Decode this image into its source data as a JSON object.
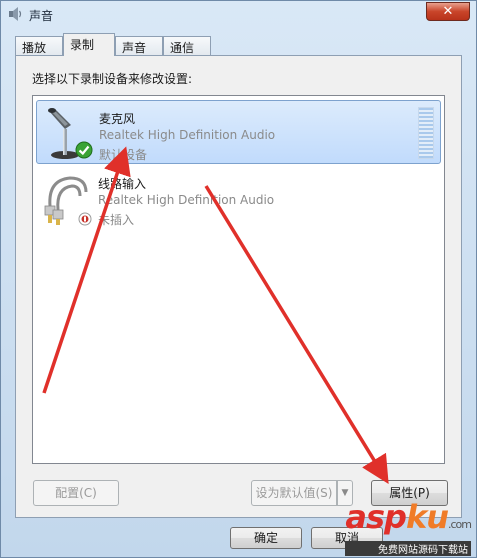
{
  "window": {
    "title": "声音",
    "close_label": "✕"
  },
  "tabs": [
    {
      "label": "播放",
      "active": false
    },
    {
      "label": "录制",
      "active": true
    },
    {
      "label": "声音",
      "active": false
    },
    {
      "label": "通信",
      "active": false
    }
  ],
  "panel": {
    "instruction": "选择以下录制设备来修改设置:",
    "devices": [
      {
        "name": "麦克风",
        "driver": "Realtek High Definition Audio",
        "status": "默认设备",
        "selected": true,
        "icon": "microphone-icon",
        "badge": "green-check-badge"
      },
      {
        "name": "线路输入",
        "driver": "Realtek High Definition Audio",
        "status": "未插入",
        "selected": false,
        "icon": "line-in-icon",
        "badge": "red-unplugged-badge"
      }
    ],
    "buttons": {
      "configure": "配置(C)",
      "set_default": "设为默认值(S)",
      "properties": "属性(P)"
    }
  },
  "footer": {
    "ok": "确定",
    "cancel": "取消"
  },
  "watermark": {
    "logo_main": "asp",
    "logo_accent": "ku",
    "logo_tld": ".com",
    "text": "免费网站源码下载站"
  },
  "colors": {
    "annotation_arrow": "#e0302a",
    "selection": "#c1dbfc"
  }
}
